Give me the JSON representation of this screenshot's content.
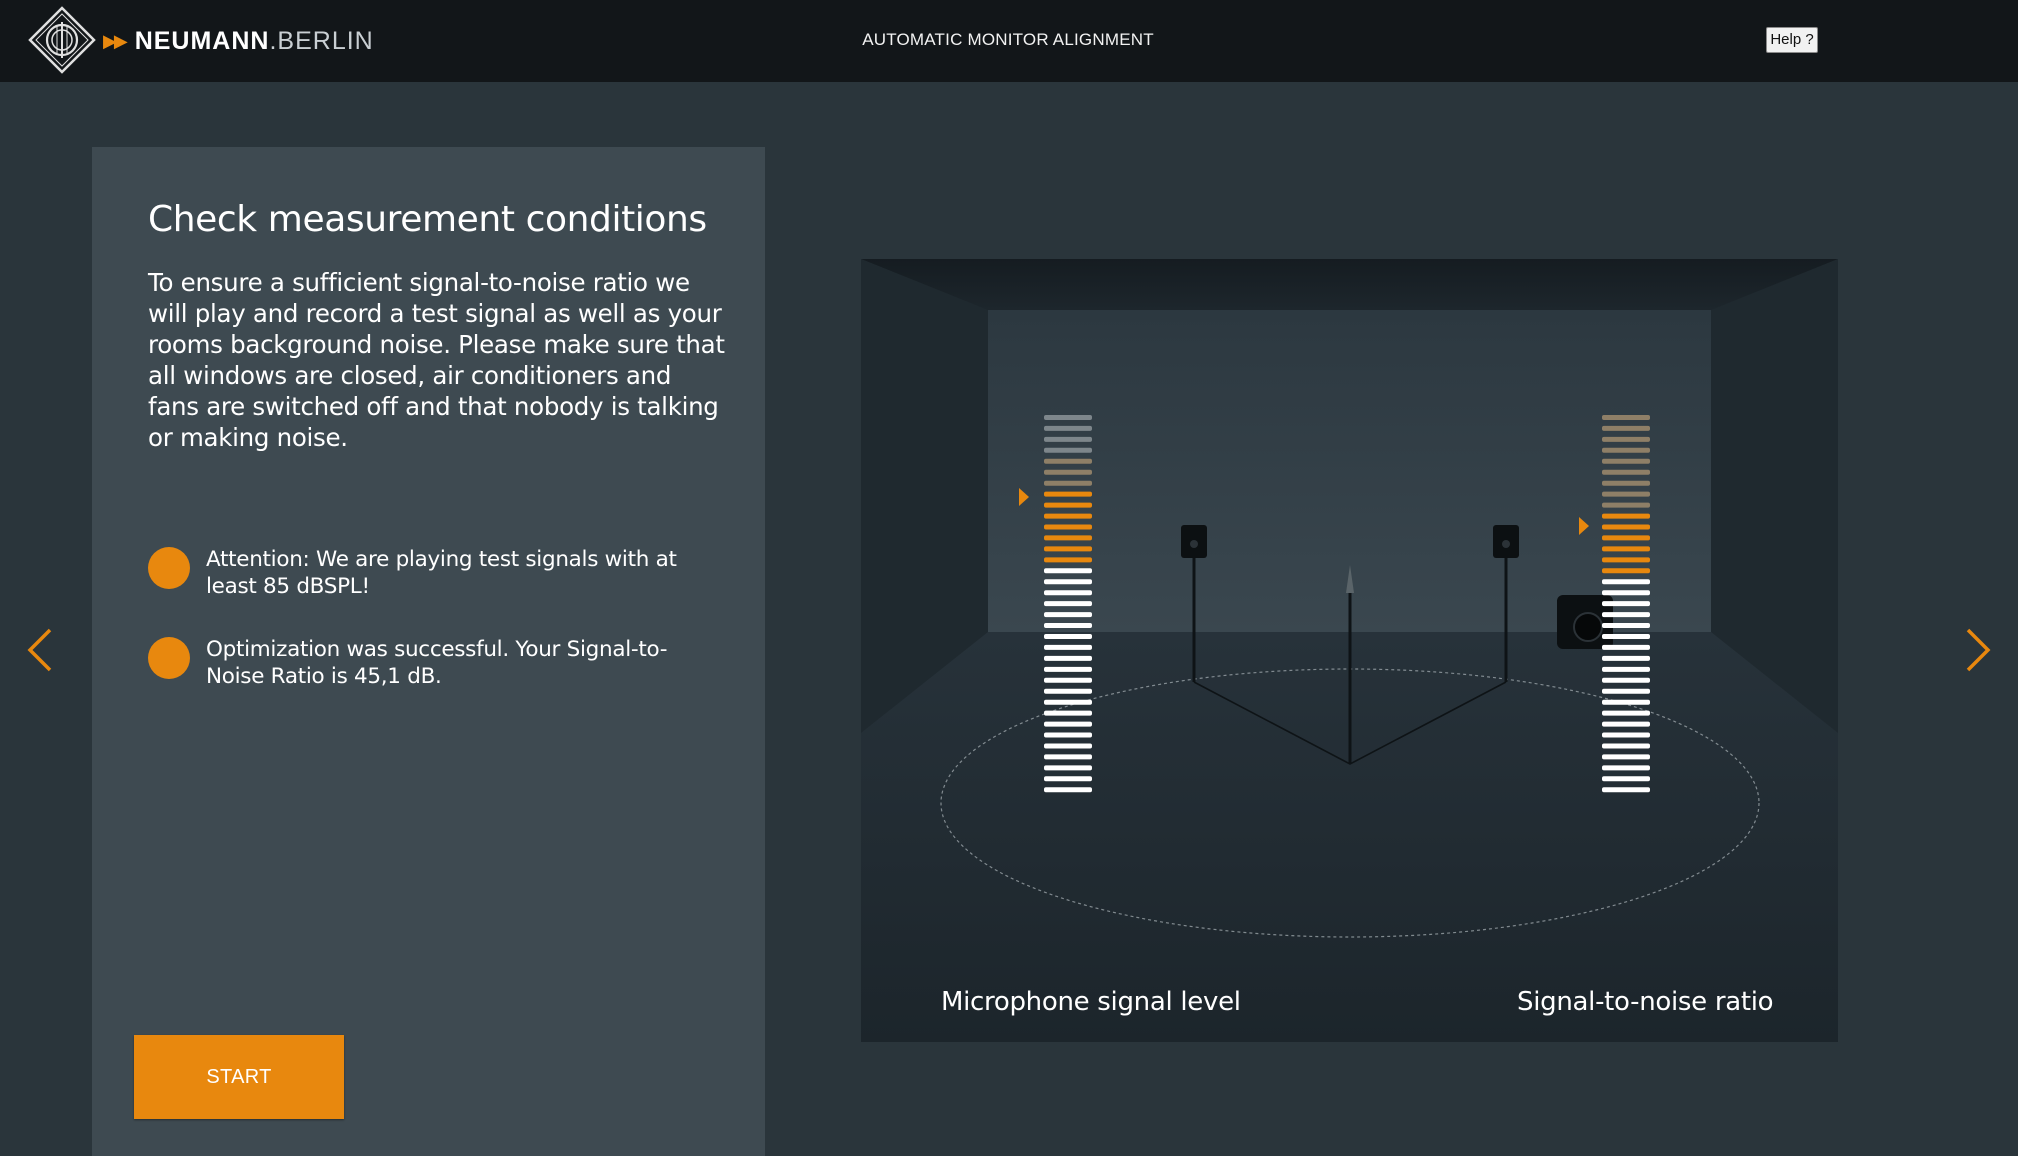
{
  "header": {
    "brand_primary": "NEUMANN",
    "brand_secondary": ".BERLIN",
    "app_title": "AUTOMATIC MONITOR ALIGNMENT",
    "help_label": "Help ?"
  },
  "panel": {
    "title": "Check measurement conditions",
    "description": "To ensure a sufficient signal-to-noise ratio we will play and record a test signal as well as your rooms background noise. Please make sure that all windows are closed, air conditioners and fans are switched off and that nobody is talking or making noise.",
    "status_items": [
      {
        "text": "Attention: We are playing test signals with at least 85 dBSPL!"
      },
      {
        "text": "Optimization was successful. Your Signal-to-Noise Ratio is 45,1 dB."
      }
    ],
    "start_label": "START"
  },
  "meters": {
    "microphone_label": "Microphone signal level",
    "snr_label": "Signal-to-noise ratio",
    "mic_segments": {
      "total": 35,
      "lit_orange": 7,
      "lit_tan": 3,
      "gray": 4
    },
    "snr_segments": {
      "total": 35,
      "lit_orange": 6,
      "lit_tan": 9,
      "gray": 0
    }
  },
  "colors": {
    "accent": "#e8880e",
    "background": "#2a353b",
    "panel": "#3e4a51",
    "topbar": "#121619"
  },
  "icons": {
    "logo": "neumann-diamond-logo",
    "prev": "chevron-left-icon",
    "next": "chevron-right-icon"
  }
}
